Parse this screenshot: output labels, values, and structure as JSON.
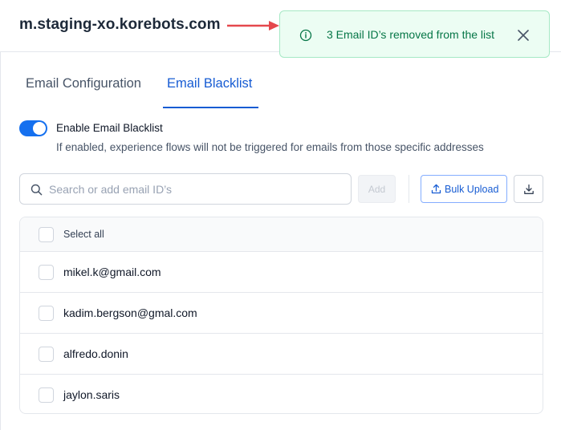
{
  "header": {
    "domain": "m.staging-xo.korebots.com"
  },
  "toast": {
    "icon": "info-circle-icon",
    "message": "3 Email ID’s removed from the list",
    "close_icon": "close-icon",
    "color": "#067647",
    "background": "#ecfdf3"
  },
  "annotation": {
    "arrow_color": "#e5484d"
  },
  "tabs": [
    {
      "label": "Email Configuration",
      "active": false
    },
    {
      "label": "Email Blacklist",
      "active": true
    }
  ],
  "blacklist": {
    "toggle_on": true,
    "toggle_label": "Enable Email Blacklist",
    "toggle_description": "If enabled, experience flows will not be triggered for emails from those specific addresses"
  },
  "search": {
    "placeholder": "Search or add email ID’s",
    "value": ""
  },
  "toolbar": {
    "add_label": "Add",
    "bulk_upload_label": "Bulk Upload",
    "download_icon": "download-icon"
  },
  "list": {
    "select_all_label": "Select all",
    "items": [
      {
        "email": "mikel.k@gmail.com",
        "checked": false
      },
      {
        "email": "kadim.bergson@gmal.com",
        "checked": false
      },
      {
        "email": "alfredo.donin",
        "checked": false
      },
      {
        "email": "jaylon.saris",
        "checked": false
      }
    ]
  },
  "colors": {
    "accent": "#175cd3",
    "toggle": "#1570ef"
  }
}
